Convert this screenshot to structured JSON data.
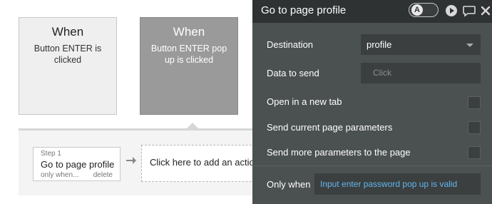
{
  "events": [
    {
      "title": "When",
      "description": "Button ENTER is clicked"
    },
    {
      "title": "When",
      "description": "Button ENTER pop up is clicked"
    }
  ],
  "steps": [
    {
      "label": "Step 1",
      "name": "Go to page profile",
      "only_when": "only when...",
      "delete": "delete"
    }
  ],
  "add_action": {
    "label": "Click here to add an action"
  },
  "editor": {
    "title": "Go to page profile",
    "toggle_letter": "A",
    "destination": {
      "label": "Destination",
      "value": "profile"
    },
    "data_to_send": {
      "label": "Data to send",
      "placeholder": "Click"
    },
    "open_new_tab": {
      "label": "Open in a new tab",
      "checked": false
    },
    "send_current_params": {
      "label": "Send current page parameters",
      "checked": false
    },
    "send_more_params": {
      "label": "Send more parameters to the page",
      "checked": false
    },
    "only_when": {
      "label": "Only when",
      "value": "Input enter password pop up is valid"
    }
  },
  "icons": {
    "play": "play-icon",
    "comment": "comment-icon",
    "close": "close-icon",
    "arrow": "arrow-right-icon"
  },
  "colors": {
    "editor_bg": "#4b5050",
    "header_bg": "#2e3232",
    "field_bg": "#3b3f3f",
    "link_blue": "#63b6f0",
    "selected_event": "#9a9a9a"
  }
}
